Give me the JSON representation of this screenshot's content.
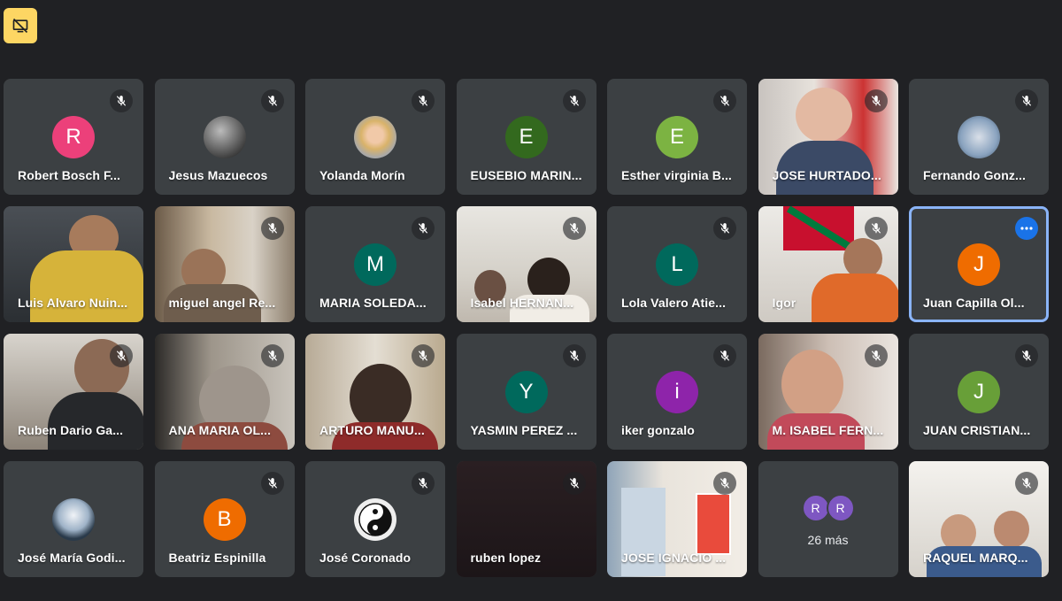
{
  "toolbar": {
    "present_icon": "no-screen-share-icon"
  },
  "tiles": [
    {
      "name": "Robert Bosch F...",
      "avatar": "R",
      "color": "#ec407a"
    },
    {
      "name": "Jesus Mazuecos",
      "photo": "moon-photo"
    },
    {
      "name": "Yolanda Morín",
      "photo": "profile-photo"
    },
    {
      "name": "EUSEBIO MARIN...",
      "avatar": "E",
      "color": "#33691e"
    },
    {
      "name": "Esther virginia B...",
      "avatar": "E",
      "color": "#7cb342"
    },
    {
      "name": "JOSE HURTADO...",
      "video": true
    },
    {
      "name": "Fernando Gonz...",
      "photo": "profile-photo"
    },
    {
      "name": "Luis Alvaro Nuin...",
      "video": true
    },
    {
      "name": "miguel angel Re...",
      "video": true
    },
    {
      "name": "MARIA SOLEDA...",
      "avatar": "M",
      "color": "#00695c"
    },
    {
      "name": "Isabel HERNAN...",
      "video": true
    },
    {
      "name": "Lola Valero Atie...",
      "avatar": "L",
      "color": "#00695c"
    },
    {
      "name": "Igor",
      "video": true
    },
    {
      "name": "Juan Capilla Ol...",
      "avatar": "J",
      "color": "#ef6c00",
      "selected": true
    },
    {
      "name": "Ruben Dario Ga...",
      "video": true
    },
    {
      "name": "ANA MARIA OL...",
      "video": true
    },
    {
      "name": "ARTURO MANU...",
      "video": true
    },
    {
      "name": "YASMIN PEREZ ...",
      "avatar": "Y",
      "color": "#00695c"
    },
    {
      "name": "iker gonzalo",
      "avatar": "i",
      "color": "#8e24aa"
    },
    {
      "name": "M. ISABEL FERN...",
      "video": true
    },
    {
      "name": "JUAN CRISTIAN...",
      "avatar": "J",
      "color": "#689f38"
    },
    {
      "name": "José María Godi...",
      "photo": "profile-photo"
    },
    {
      "name": "Beatriz Espinilla",
      "avatar": "B",
      "color": "#ef6c00"
    },
    {
      "name": "José Coronado",
      "photo": "yin-yang-photo"
    },
    {
      "name": "ruben lopez",
      "video": true
    },
    {
      "name": "JOSE IGNACIO ...",
      "video": true
    }
  ],
  "more_tile": {
    "avatars": [
      "R",
      "R"
    ],
    "label": "26 más"
  },
  "last_tile": {
    "name": "RAQUEL MARQ..."
  }
}
